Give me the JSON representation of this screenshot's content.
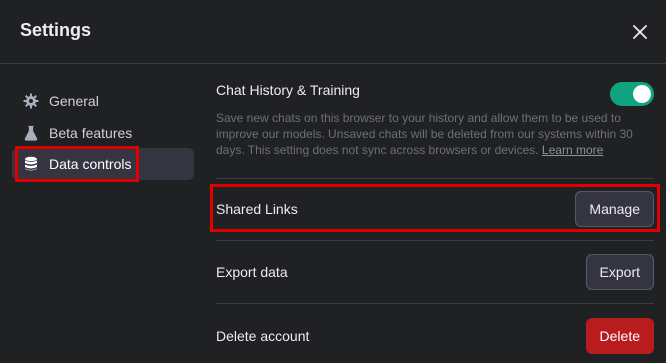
{
  "dialog": {
    "title": "Settings",
    "close_icon": "close-icon"
  },
  "sidebar": {
    "items": [
      {
        "label": "General",
        "icon": "gear-icon",
        "active": false
      },
      {
        "label": "Beta features",
        "icon": "flask-icon",
        "active": false
      },
      {
        "label": "Data controls",
        "icon": "database-icon",
        "active": true
      }
    ]
  },
  "data_controls": {
    "chat_history": {
      "label": "Chat History & Training",
      "enabled": true,
      "description": "Save new chats on this browser to your history and allow them to be used to improve our models. Unsaved chats will be deleted from our systems within 30 days. This setting does not sync across browsers or devices. ",
      "learn_more": "Learn more"
    },
    "shared_links": {
      "label": "Shared Links",
      "button": "Manage"
    },
    "export_data": {
      "label": "Export data",
      "button": "Export"
    },
    "delete_account": {
      "label": "Delete account",
      "button": "Delete"
    }
  },
  "colors": {
    "background": "#202123",
    "accent_toggle": "#10a37f",
    "danger": "#b91c1c",
    "annotation_highlight": "#e00000"
  }
}
